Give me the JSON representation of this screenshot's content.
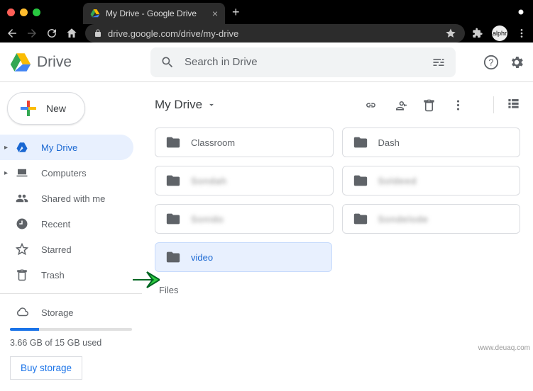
{
  "browser": {
    "tab_title": "My Drive - Google Drive",
    "url": "drive.google.com/drive/my-drive",
    "avatar": "alphr"
  },
  "header": {
    "product": "Drive",
    "search_placeholder": "Search in Drive"
  },
  "sidebar": {
    "new_label": "New",
    "items": [
      {
        "label": "My Drive"
      },
      {
        "label": "Computers"
      },
      {
        "label": "Shared with me"
      },
      {
        "label": "Recent"
      },
      {
        "label": "Starred"
      },
      {
        "label": "Trash"
      }
    ],
    "storage_label": "Storage",
    "storage_text": "3.66 GB of 15 GB used",
    "buy_label": "Buy storage"
  },
  "main": {
    "breadcrumb": "My Drive",
    "folders": [
      {
        "label": "Classroom"
      },
      {
        "label": "Dash"
      },
      {
        "label": "Sondah",
        "blurred": true
      },
      {
        "label": "Soldeed",
        "blurred": true
      },
      {
        "label": "Sonido",
        "blurred": true
      },
      {
        "label": "Sondelode",
        "blurred": true
      },
      {
        "label": "video",
        "selected": true
      }
    ],
    "files_label": "Files"
  },
  "watermark": "www.deuaq.com"
}
